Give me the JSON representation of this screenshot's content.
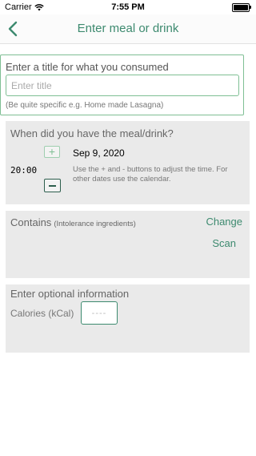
{
  "status_bar": {
    "carrier": "Carrier",
    "time": "7:55 PM"
  },
  "nav": {
    "title": "Enter meal or drink",
    "back_icon": "chevron-left-icon"
  },
  "title_section": {
    "label": "Enter a title for what you consumed",
    "placeholder": "Enter title",
    "value": "",
    "hint": "(Be quite specific e.g. Home made Lasagna)"
  },
  "when_section": {
    "label": "When did you have the meal/drink?",
    "plus_label": "+",
    "time": "20:00",
    "date": "Sep 9, 2020",
    "hint": "Use the + and - buttons to adjust the time. For other dates use the calendar."
  },
  "contains_section": {
    "label": "Contains",
    "sublabel": "(Intolerance ingredients)",
    "change_label": "Change",
    "scan_label": "Scan"
  },
  "optional_section": {
    "label": "Enter optional information",
    "calories_label": "Calories (kCal)",
    "calories_placeholder": "----"
  },
  "colors": {
    "accent": "#3d8a6f",
    "border_light": "#7fbf94",
    "section_bg": "#eaeaea"
  }
}
